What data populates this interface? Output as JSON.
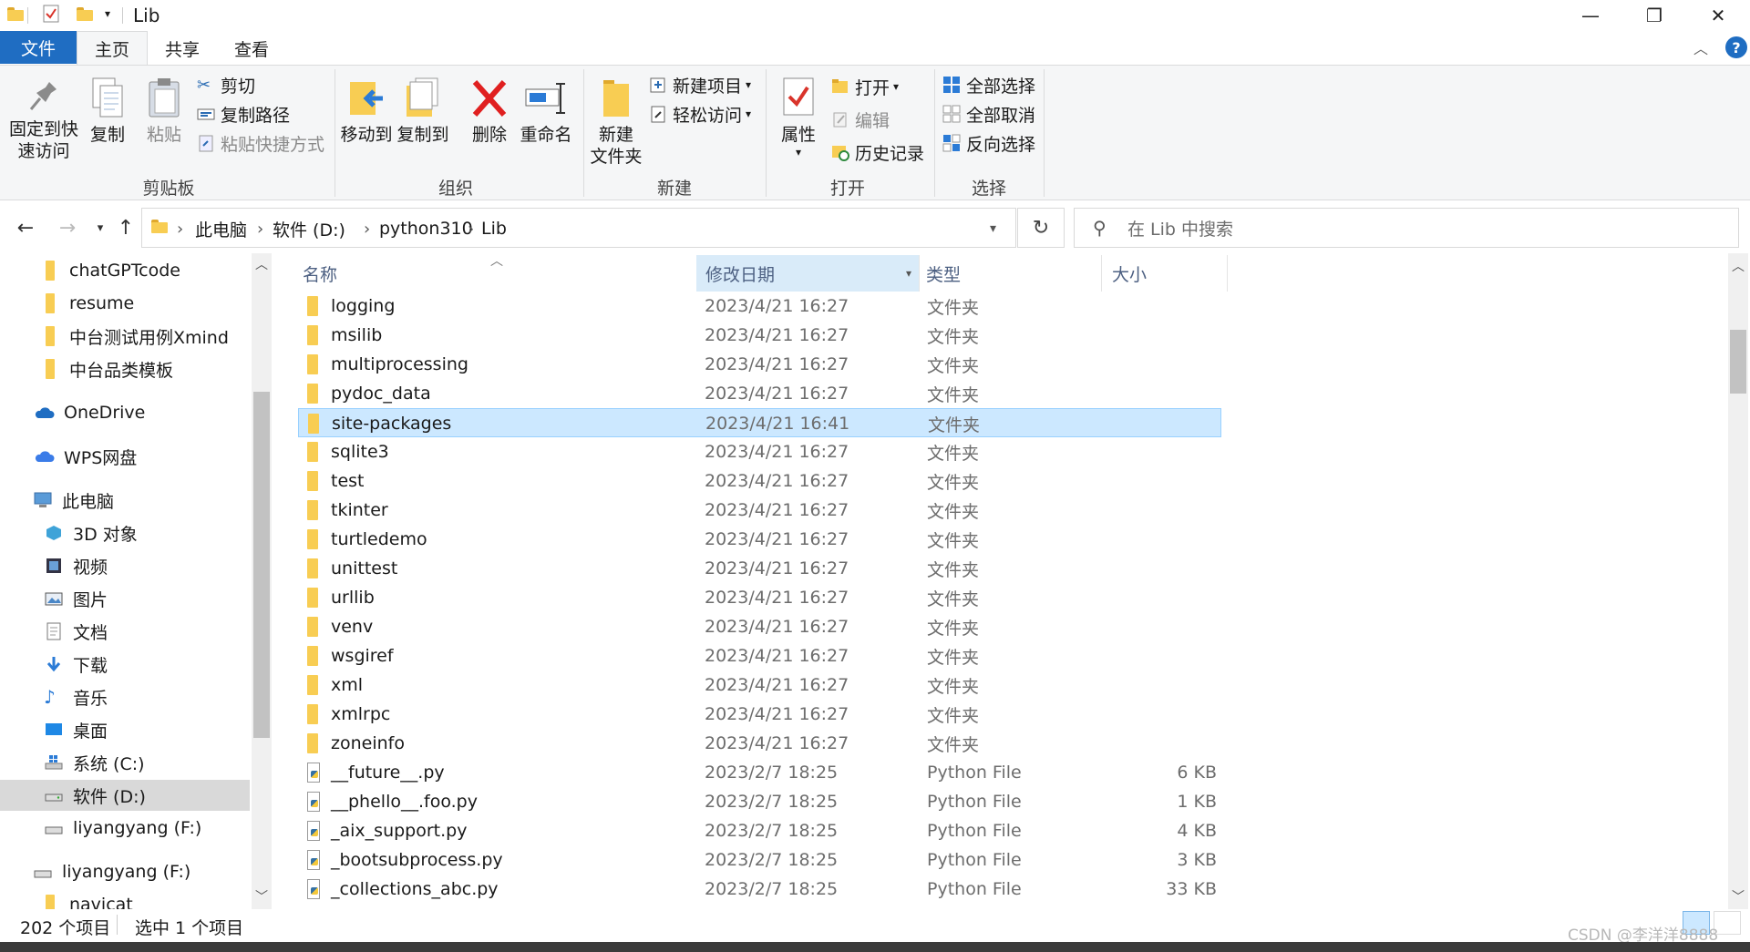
{
  "window": {
    "title": "Lib",
    "qat_dropdown": "▾",
    "min_glyph": "—",
    "max_glyph": "❐",
    "close_glyph": "✕"
  },
  "menu": {
    "file": "文件",
    "tabs": [
      "主页",
      "共享",
      "查看"
    ],
    "collapse_glyph": "︿",
    "help_glyph": "?"
  },
  "ribbon": {
    "clipboard": {
      "pin": "固定到快\n速访问",
      "pin_l1": "固定到快",
      "pin_l2": "速访问",
      "copy": "复制",
      "paste": "粘贴",
      "cut": "剪切",
      "copy_path": "复制路径",
      "paste_shortcut": "粘贴快捷方式",
      "group": "剪贴板"
    },
    "organize": {
      "move_to": "移动到",
      "copy_to": "复制到",
      "delete": "删除",
      "rename": "重命名",
      "group": "组织"
    },
    "new": {
      "new_folder_l1": "新建",
      "new_folder_l2": "文件夹",
      "new_item": "新建项目",
      "easy_access": "轻松访问",
      "group": "新建"
    },
    "open": {
      "properties": "属性",
      "open": "打开",
      "edit": "编辑",
      "history": "历史记录",
      "group": "打开"
    },
    "select": {
      "select_all": "全部选择",
      "select_none": "全部取消",
      "invert": "反向选择",
      "group": "选择"
    }
  },
  "address": {
    "crumbs": [
      "此电脑",
      "软件 (D:)",
      "python310",
      "Lib"
    ],
    "search_placeholder": "在 Lib 中搜索"
  },
  "nav": {
    "items": [
      "chatGPTcode",
      "resume",
      "中台测试用例Xmind",
      "中台品类模板",
      "OneDrive",
      "WPS网盘",
      "此电脑",
      "3D 对象",
      "视频",
      "图片",
      "文档",
      "下载",
      "音乐",
      "桌面",
      "系统 (C:)",
      "软件 (D:)",
      "liyangyang (F:)",
      "liyangyang (F:)",
      "navicat"
    ]
  },
  "list": {
    "columns": {
      "name": "名称",
      "date": "修改日期",
      "type": "类型",
      "size": "大小"
    },
    "rows": [
      {
        "name": "logging",
        "date": "2023/4/21 16:27",
        "type": "文件夹",
        "size": "",
        "kind": "folder"
      },
      {
        "name": "msilib",
        "date": "2023/4/21 16:27",
        "type": "文件夹",
        "size": "",
        "kind": "folder"
      },
      {
        "name": "multiprocessing",
        "date": "2023/4/21 16:27",
        "type": "文件夹",
        "size": "",
        "kind": "folder"
      },
      {
        "name": "pydoc_data",
        "date": "2023/4/21 16:27",
        "type": "文件夹",
        "size": "",
        "kind": "folder"
      },
      {
        "name": "site-packages",
        "date": "2023/4/21 16:41",
        "type": "文件夹",
        "size": "",
        "kind": "folder",
        "selected": true
      },
      {
        "name": "sqlite3",
        "date": "2023/4/21 16:27",
        "type": "文件夹",
        "size": "",
        "kind": "folder"
      },
      {
        "name": "test",
        "date": "2023/4/21 16:27",
        "type": "文件夹",
        "size": "",
        "kind": "folder"
      },
      {
        "name": "tkinter",
        "date": "2023/4/21 16:27",
        "type": "文件夹",
        "size": "",
        "kind": "folder"
      },
      {
        "name": "turtledemo",
        "date": "2023/4/21 16:27",
        "type": "文件夹",
        "size": "",
        "kind": "folder"
      },
      {
        "name": "unittest",
        "date": "2023/4/21 16:27",
        "type": "文件夹",
        "size": "",
        "kind": "folder"
      },
      {
        "name": "urllib",
        "date": "2023/4/21 16:27",
        "type": "文件夹",
        "size": "",
        "kind": "folder"
      },
      {
        "name": "venv",
        "date": "2023/4/21 16:27",
        "type": "文件夹",
        "size": "",
        "kind": "folder"
      },
      {
        "name": "wsgiref",
        "date": "2023/4/21 16:27",
        "type": "文件夹",
        "size": "",
        "kind": "folder"
      },
      {
        "name": "xml",
        "date": "2023/4/21 16:27",
        "type": "文件夹",
        "size": "",
        "kind": "folder"
      },
      {
        "name": "xmlrpc",
        "date": "2023/4/21 16:27",
        "type": "文件夹",
        "size": "",
        "kind": "folder"
      },
      {
        "name": "zoneinfo",
        "date": "2023/4/21 16:27",
        "type": "文件夹",
        "size": "",
        "kind": "folder"
      },
      {
        "name": "__future__.py",
        "date": "2023/2/7 18:25",
        "type": "Python File",
        "size": "6 KB",
        "kind": "py"
      },
      {
        "name": "__phello__.foo.py",
        "date": "2023/2/7 18:25",
        "type": "Python File",
        "size": "1 KB",
        "kind": "py"
      },
      {
        "name": "_aix_support.py",
        "date": "2023/2/7 18:25",
        "type": "Python File",
        "size": "4 KB",
        "kind": "py"
      },
      {
        "name": "_bootsubprocess.py",
        "date": "2023/2/7 18:25",
        "type": "Python File",
        "size": "3 KB",
        "kind": "py"
      },
      {
        "name": "_collections_abc.py",
        "date": "2023/2/7 18:25",
        "type": "Python File",
        "size": "33 KB",
        "kind": "py"
      }
    ]
  },
  "status": {
    "count": "202 个项目",
    "selected": "选中 1 个项目"
  },
  "watermark": "CSDN @李洋洋8888",
  "colors": {
    "accent": "#1f6dc2",
    "selection": "#cce8ff",
    "folder": "#f8cd53"
  }
}
